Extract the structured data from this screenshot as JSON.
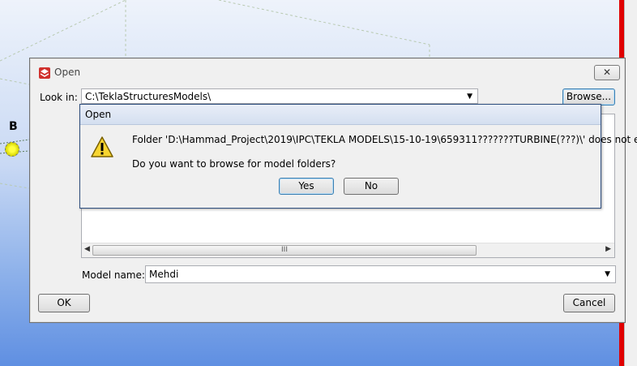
{
  "background": {
    "node_label": "B",
    "accent_colors": {
      "rail": "#e00000",
      "selection": "#3399ff"
    }
  },
  "open_dialog": {
    "title": "Open",
    "app_icon": "tekla-logo-icon",
    "close_label": "✕",
    "look_in_label": "Look in:",
    "look_in_value": "C:\\TeklaStructuresModels\\",
    "browse_label": "Browse...",
    "model_name_label": "Model name:",
    "model_name_value": "Mehdi",
    "scroll_thumb_grip": "III",
    "ok_label": "OK",
    "cancel_label": "Cancel"
  },
  "message_box": {
    "title": "Open",
    "icon": "warning-icon",
    "line1": "Folder 'D:\\Hammad_Project\\2019\\IPC\\TEKLA MODELS\\15-10-19\\659311???????TURBINE(???)\\' does not exist.",
    "line2": "Do you want to browse for model folders?",
    "yes_label": "Yes",
    "no_label": "No"
  }
}
